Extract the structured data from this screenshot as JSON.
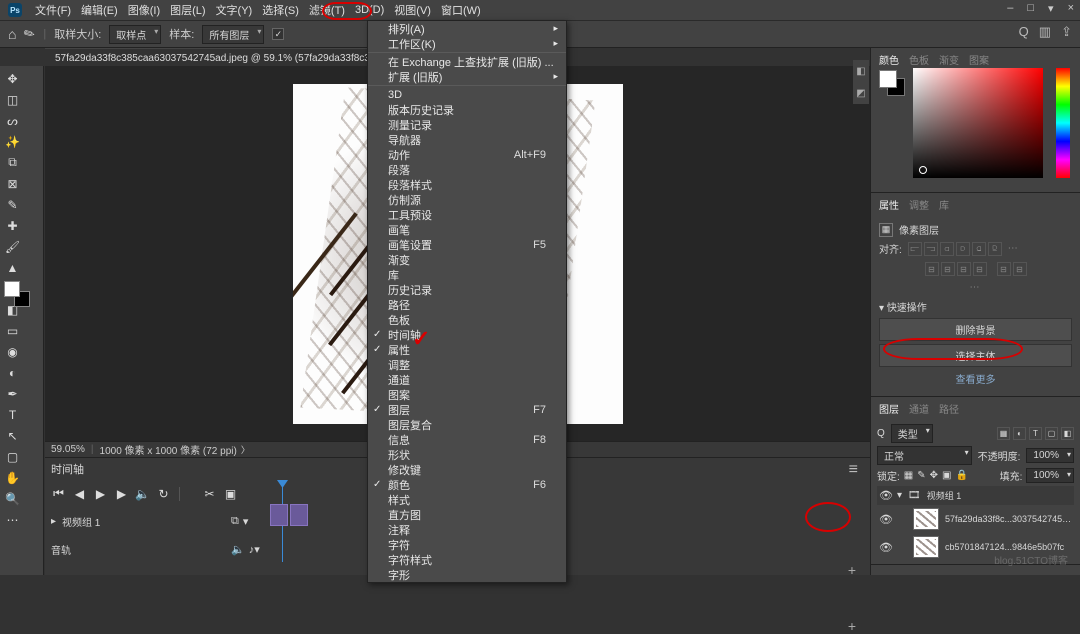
{
  "app": {
    "logo_text": "Ps"
  },
  "menubar": {
    "items": [
      "文件(F)",
      "编辑(E)",
      "图像(I)",
      "图层(L)",
      "文字(Y)",
      "选择(S)",
      "滤镜(T)",
      "3D(D)",
      "视图(V)",
      "窗口(W)"
    ]
  },
  "winctrl": {
    "min": "–",
    "max": "□",
    "fold": "▾",
    "close": "×"
  },
  "optbar": {
    "sample_label": "取样大小:",
    "sample_value": "取样点",
    "layer_label": "样本:",
    "layer_value": "所有图层",
    "checkbox_checked": "✓"
  },
  "optright": {
    "search": "Q",
    "workspace": "▥",
    "share": "⇪"
  },
  "doctab": {
    "title": "57fa29da33f8c385caa63037542745ad.jpeg @ 59.1% (57fa29da33f8c385caa630375...)",
    "close": "×"
  },
  "ddmenu": {
    "items": [
      {
        "label": "排列(A)",
        "sub": true
      },
      {
        "label": "工作区(K)",
        "sub": true
      },
      {
        "sep": true
      },
      {
        "label": "在 Exchange 上查找扩展 (旧版) ..."
      },
      {
        "label": "扩展 (旧版)",
        "sub": true
      },
      {
        "sep": true
      },
      {
        "label": "3D"
      },
      {
        "label": "版本历史记录"
      },
      {
        "label": "测量记录"
      },
      {
        "label": "导航器"
      },
      {
        "label": "动作",
        "shortcut": "Alt+F9"
      },
      {
        "label": "段落"
      },
      {
        "label": "段落样式"
      },
      {
        "label": "仿制源"
      },
      {
        "label": "工具预设"
      },
      {
        "label": "画笔"
      },
      {
        "label": "画笔设置",
        "shortcut": "F5"
      },
      {
        "label": "渐变"
      },
      {
        "label": "库"
      },
      {
        "label": "历史记录"
      },
      {
        "label": "路径"
      },
      {
        "label": "色板"
      },
      {
        "label": "时间轴",
        "checked": true
      },
      {
        "label": "属性",
        "checked": true
      },
      {
        "label": "调整"
      },
      {
        "label": "通道"
      },
      {
        "label": "图案"
      },
      {
        "label": "图层",
        "checked": true,
        "shortcut": "F7"
      },
      {
        "label": "图层复合"
      },
      {
        "label": "信息",
        "shortcut": "F8"
      },
      {
        "label": "形状"
      },
      {
        "label": "修改键"
      },
      {
        "label": "颜色",
        "checked": true,
        "shortcut": "F6"
      },
      {
        "label": "样式"
      },
      {
        "label": "直方图"
      },
      {
        "label": "注释"
      },
      {
        "label": "字符"
      },
      {
        "label": "字符样式"
      },
      {
        "label": "字形"
      }
    ]
  },
  "statusbar": {
    "zoom": "59.05%",
    "info": "1000 像素 x 1000 像素 (72 ppi)",
    "arrow": "〉"
  },
  "timeline": {
    "tab": "时间轴",
    "group_name": "视频组 1",
    "audio_name": "音轨",
    "plus": "+",
    "turn": "⭯",
    "menu": "≡"
  },
  "rightPanels": {
    "color": {
      "tabs": [
        "颜色",
        "色板",
        "渐变",
        "图案"
      ]
    },
    "props": {
      "tabs": [
        "属性",
        "调整",
        "库"
      ],
      "kind": "像素图层",
      "align_label": "对齐:",
      "quick_title": "快速操作",
      "btn_remove_bg": "删除背景",
      "btn_select_subject": "选择主体",
      "more": "查看更多"
    },
    "layers": {
      "tabs": [
        "图层",
        "通道",
        "路径"
      ],
      "kind": "类型",
      "mode": "正常",
      "opacity_label": "不透明度:",
      "opacity_value": "100%",
      "lock_label": "锁定:",
      "fill_label": "填充:",
      "fill_value": "100%",
      "group": "视频组 1",
      "items": [
        {
          "name": "57fa29da33f8c...3037542745ad"
        },
        {
          "name": "cb5701847124...9846e5b07fc"
        }
      ]
    }
  },
  "watermark": "blog.51CTO博客"
}
